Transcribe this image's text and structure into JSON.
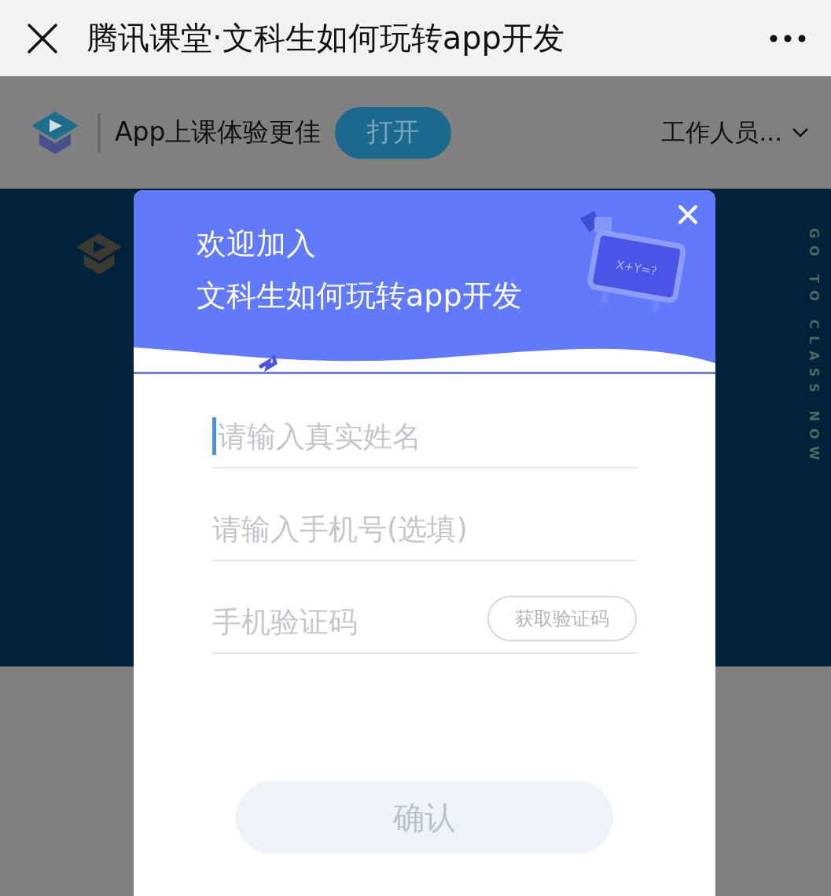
{
  "title_bar": {
    "title": "腾讯课堂·文科生如何玩转app开发"
  },
  "promo_bar": {
    "text": "App上课体验更佳",
    "open_button": "打开",
    "user_menu": "工作人员..."
  },
  "banner": {
    "tagline": "GO TO CLASS NOW"
  },
  "dialog": {
    "heading_lines": [
      "欢迎加入",
      "文科生如何玩转app开发"
    ],
    "illustration_text": "X+Y=?",
    "fields": [
      {
        "kind": "text",
        "placeholder": "请输入真实姓名",
        "focused": true
      },
      {
        "kind": "text",
        "placeholder": "请输入手机号(选填)",
        "focused": false
      },
      {
        "kind": "code",
        "placeholder": "手机验证码",
        "action": "获取验证码",
        "focused": false
      }
    ],
    "confirm_button": {
      "label": "确认",
      "disabled": true
    }
  }
}
